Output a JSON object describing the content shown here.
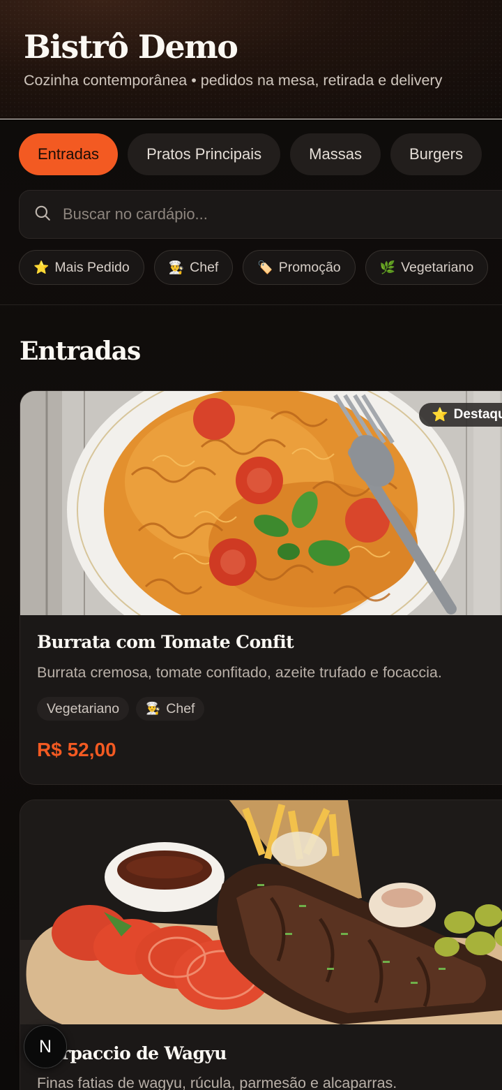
{
  "header": {
    "title": "Bistrô Demo",
    "subtitle": "Cozinha contemporânea • pedidos na mesa, retirada e delivery"
  },
  "tabs": [
    {
      "label": "Entradas",
      "active": true
    },
    {
      "label": "Pratos Principais",
      "active": false
    },
    {
      "label": "Massas",
      "active": false
    },
    {
      "label": "Burgers",
      "active": false
    }
  ],
  "search": {
    "placeholder": "Buscar no cardápio...",
    "icon": "search-icon"
  },
  "filters": [
    {
      "icon": "star-icon",
      "glyph": "⭐",
      "label": "Mais Pedido"
    },
    {
      "icon": "chef-icon",
      "glyph": "👨‍🍳",
      "label": "Chef"
    },
    {
      "icon": "tag-icon",
      "glyph": "🏷️",
      "label": "Promoção"
    },
    {
      "icon": "leaf-icon",
      "glyph": "🌿",
      "label": "Vegetariano"
    }
  ],
  "section": {
    "title": "Entradas"
  },
  "items": [
    {
      "photo": "pasta-photo",
      "badge": {
        "icon": "star-icon",
        "glyph": "⭐",
        "label": "Destaque"
      },
      "name": "Burrata com Tomate Confit",
      "description": "Burrata cremosa, tomate confitado, azeite trufado e focaccia.",
      "tags": [
        {
          "label": "Vegetariano"
        },
        {
          "icon": "chef-icon",
          "glyph": "👨‍🍳",
          "label": "Chef"
        }
      ],
      "price": "R$ 52,00"
    },
    {
      "photo": "ribs-photo",
      "name": "Carpaccio de Wagyu",
      "description": "Finas fatias de wagyu, rúcula, parmesão e alcaparras."
    }
  ],
  "floating_button": {
    "label": "N"
  },
  "colors": {
    "accent": "#f35a22",
    "background": "#0c0a09",
    "card": "#1b1817"
  }
}
